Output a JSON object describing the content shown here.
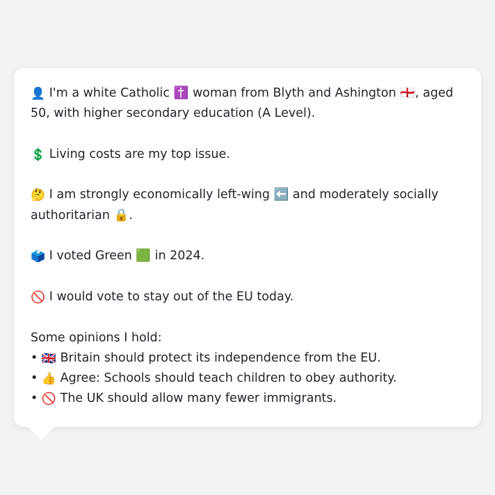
{
  "profile": {
    "intro": {
      "emoji": "👤",
      "text": "I'm a white Catholic ✝️ woman from Blyth and Ashington 🏴󠁧󠁢󠁥󠁮󠁧󠁿, aged 50, with higher secondary education (A Level)."
    },
    "issue": {
      "emoji": "💲",
      "text": "Living costs are my top issue."
    },
    "ideology": {
      "emoji": "🤔",
      "text": "I am strongly economically left-wing ⬅️ and moderately socially authoritarian 🔒."
    },
    "vote": {
      "emoji": "🗳️",
      "text": "I voted Green 🟩 in 2024."
    },
    "eu": {
      "emoji": "🚫",
      "text": "I would vote to stay out of the EU today."
    },
    "opinions_heading": "Some opinions I hold:",
    "opinions": [
      {
        "bullet": "•",
        "emoji": "🇬🇧",
        "text": "Britain should protect its independence from the EU."
      },
      {
        "bullet": "•",
        "emoji": "👍",
        "text": "Agree: Schools should teach children to obey authority."
      },
      {
        "bullet": "•",
        "emoji": "🚫",
        "text": "The UK should allow many fewer immigrants."
      }
    ]
  }
}
